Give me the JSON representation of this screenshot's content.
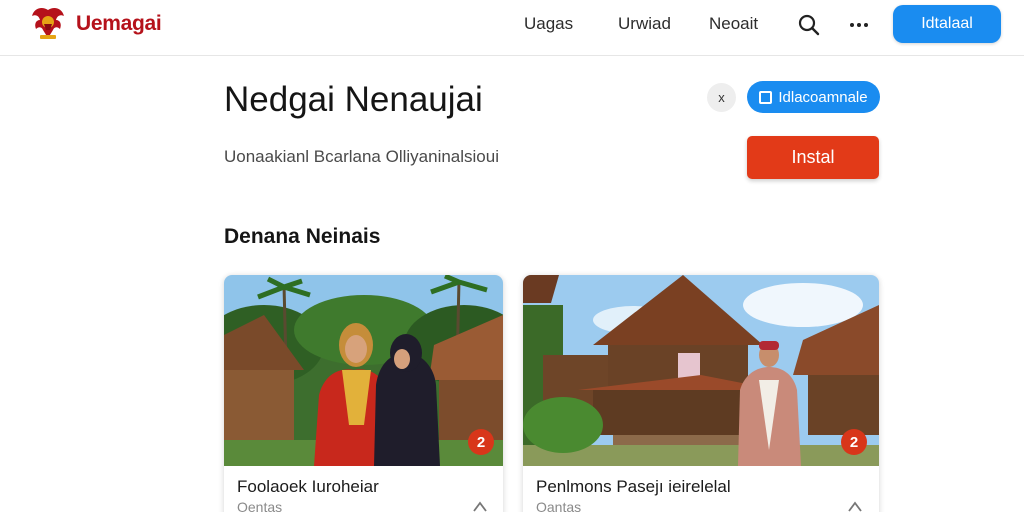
{
  "header": {
    "brand": "Uemagai",
    "logo_icon": "eagle-emblem-icon",
    "nav": [
      "Uagas",
      "Urwiad",
      "Neoait"
    ],
    "search_icon": "search-icon",
    "more_icon": "more-dots-icon",
    "cta": "Idtalaal"
  },
  "hero": {
    "title": "Nedgai Nenaujai",
    "subtitle": "Uonaakianl Bcarlana Olliyaninalsioui",
    "close_icon": "close-icon",
    "close_label": "x",
    "pill_button": "Idlacoamnale",
    "install_button": "Instal"
  },
  "section": {
    "title": "Denana Neinais"
  },
  "cards": [
    {
      "title": "Foolaoek Iuroheiar",
      "meta": "Oentas",
      "badge": "2",
      "image": "two-women-traditional-dress-village-photo"
    },
    {
      "title": "Penlmons Pasejı ieirelelal",
      "meta": "Oantas",
      "badge": "2",
      "image": "man-traditional-wooden-house-photo"
    }
  ],
  "colors": {
    "brand": "#b5121b",
    "primary": "#1a8cf0",
    "install": "#e23a18"
  }
}
